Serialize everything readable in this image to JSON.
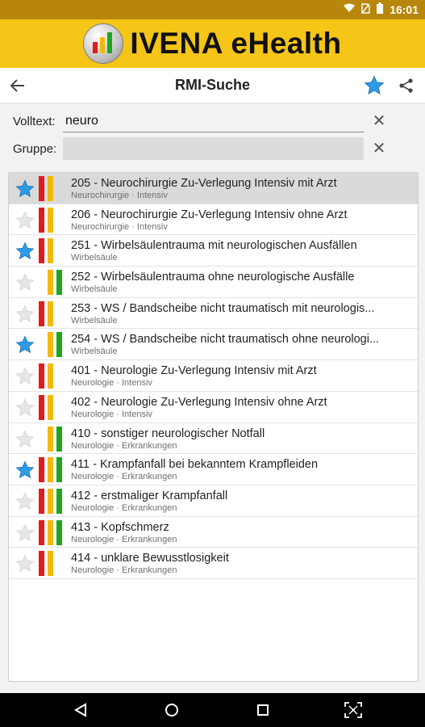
{
  "statusbar": {
    "time": "16:01"
  },
  "brand": {
    "title": "IVENA eHealth"
  },
  "toolbar": {
    "title": "RMI-Suche",
    "back_icon": "arrow-back-icon",
    "fav_icon": "star-icon",
    "share_icon": "share-icon"
  },
  "form": {
    "volltext_label": "Volltext:",
    "volltext_value": "neuro",
    "gruppe_label": "Gruppe:",
    "gruppe_value": "",
    "clear_glyph": "✕"
  },
  "colors": {
    "accent_yellow": "#f5c518",
    "star_blue": "#2f9be6",
    "star_empty": "#e6e6e6",
    "bar_red": "#e21b1b",
    "bar_yellow": "#f2b90f",
    "bar_green": "#1fa51f"
  },
  "list": {
    "items": [
      {
        "code": "205",
        "title": "205 - Neurochirurgie Zu-Verlegung Intensiv mit Arzt",
        "sub": "Neurochirurgie · Intensiv",
        "starred": true,
        "bars": [
          "red",
          "yellow"
        ],
        "selected": true
      },
      {
        "code": "206",
        "title": "206 - Neurochirurgie Zu-Verlegung Intensiv ohne Arzt",
        "sub": "Neurochirurgie · Intensiv",
        "starred": false,
        "bars": [
          "red",
          "yellow"
        ],
        "selected": false
      },
      {
        "code": "251",
        "title": "251 - Wirbelsäulentrauma mit neurologischen Ausfällen",
        "sub": "Wirbelsäule",
        "starred": true,
        "bars": [
          "red",
          "yellow"
        ],
        "selected": false
      },
      {
        "code": "252",
        "title": "252 - Wirbelsäulentrauma ohne neurologische Ausfälle",
        "sub": "Wirbelsäule",
        "starred": false,
        "bars": [
          "yellow",
          "green"
        ],
        "selected": false
      },
      {
        "code": "253",
        "title": "253 - WS / Bandscheibe nicht traumatisch mit neurologis...",
        "sub": "Wirbelsäule",
        "starred": false,
        "bars": [
          "red",
          "yellow"
        ],
        "selected": false
      },
      {
        "code": "254",
        "title": "254 - WS / Bandscheibe nicht traumatisch ohne neurologi...",
        "sub": "Wirbelsäule",
        "starred": true,
        "bars": [
          "yellow",
          "green"
        ],
        "selected": false
      },
      {
        "code": "401",
        "title": "401 - Neurologie Zu-Verlegung Intensiv mit Arzt",
        "sub": "Neurologie · Intensiv",
        "starred": false,
        "bars": [
          "red",
          "yellow"
        ],
        "selected": false
      },
      {
        "code": "402",
        "title": "402 - Neurologie Zu-Verlegung Intensiv ohne Arzt",
        "sub": "Neurologie · Intensiv",
        "starred": false,
        "bars": [
          "red",
          "yellow"
        ],
        "selected": false
      },
      {
        "code": "410",
        "title": "410 - sonstiger neurologischer Notfall",
        "sub": "Neurologie · Erkrankungen",
        "starred": false,
        "bars": [
          "yellow",
          "green"
        ],
        "selected": false
      },
      {
        "code": "411",
        "title": "411 - Krampfanfall bei bekanntem Krampfleiden",
        "sub": "Neurologie · Erkrankungen",
        "starred": true,
        "bars": [
          "red",
          "yellow",
          "green"
        ],
        "selected": false
      },
      {
        "code": "412",
        "title": "412 - erstmaliger Krampfanfall",
        "sub": "Neurologie · Erkrankungen",
        "starred": false,
        "bars": [
          "red",
          "yellow",
          "green"
        ],
        "selected": false
      },
      {
        "code": "413",
        "title": "413 - Kopfschmerz",
        "sub": "Neurologie · Erkrankungen",
        "starred": false,
        "bars": [
          "red",
          "yellow",
          "green"
        ],
        "selected": false
      },
      {
        "code": "414",
        "title": "414 - unklare Bewusstlosigkeit",
        "sub": "Neurologie · Erkrankungen",
        "starred": false,
        "bars": [
          "red",
          "yellow"
        ],
        "selected": false
      }
    ]
  },
  "navbar": {
    "back_icon": "nav-back-icon",
    "home_icon": "nav-home-icon",
    "recents_icon": "nav-recents-icon",
    "screenshot_icon": "screen-capture-icon"
  }
}
